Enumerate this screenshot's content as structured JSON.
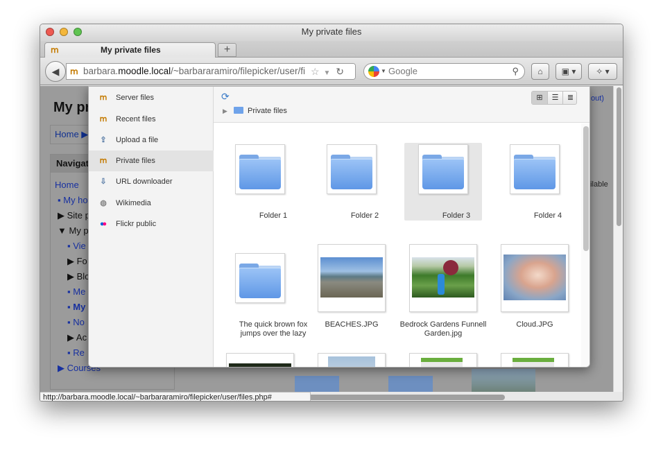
{
  "window": {
    "title": "My private files"
  },
  "tab": {
    "label": "My private files"
  },
  "address": {
    "host_prefix": "barbara.",
    "host_main": "moodle.local",
    "path": "/~barbararamiro/filepicker/user/fi"
  },
  "search": {
    "placeholder": "Google"
  },
  "status_url": "http://barbara.moodle.local/~barbararamiro/filepicker/user/files.php#",
  "background": {
    "page_title": "My pr",
    "breadcrumb_home": "Home",
    "nav_header": "Navigat",
    "nav_items": [
      "Home",
      "My ho",
      "Site p",
      "My pr",
      "Vie",
      "Fo",
      "Blo",
      "Me",
      "My",
      "No",
      "Ac",
      "Re",
      "Courses"
    ],
    "right_label": "ailable",
    "right_link": "out)"
  },
  "repositories": [
    {
      "label": "Server files",
      "icon": "moodle-icon"
    },
    {
      "label": "Recent files",
      "icon": "moodle-icon"
    },
    {
      "label": "Upload a file",
      "icon": "upload-icon"
    },
    {
      "label": "Private files",
      "icon": "moodle-icon",
      "active": true
    },
    {
      "label": "URL downloader",
      "icon": "url-download-icon"
    },
    {
      "label": "Wikimedia",
      "icon": "wikimedia-icon"
    },
    {
      "label": "Flickr public",
      "icon": "flickr-icon"
    }
  ],
  "breadcrumb": {
    "folder": "Private files"
  },
  "files": [
    {
      "name": "Folder 1",
      "type": "folder"
    },
    {
      "name": "Folder 2",
      "type": "folder"
    },
    {
      "name": "Folder 3",
      "type": "folder",
      "selected": true
    },
    {
      "name": "Folder 4",
      "type": "folder"
    },
    {
      "name": "The quick brown fox jumps over the lazy",
      "type": "folder"
    },
    {
      "name": "BEACHES.JPG",
      "type": "image"
    },
    {
      "name": "Bedrock Gardens Funnell Garden.jpg",
      "type": "image"
    },
    {
      "name": "Cloud.JPG",
      "type": "image"
    }
  ],
  "colors": {
    "accent": "#3a7bc8",
    "folder": "#6fa3ea",
    "link": "#1a4fd6"
  }
}
